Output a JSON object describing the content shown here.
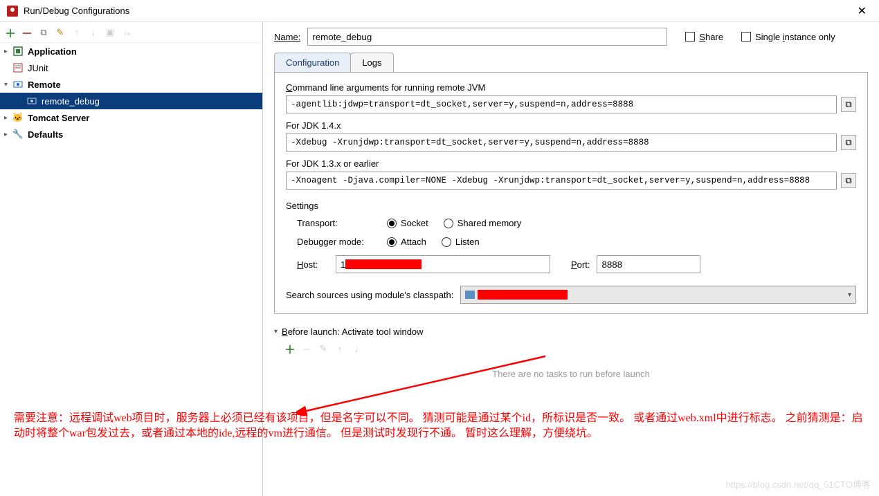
{
  "window": {
    "title": "Run/Debug Configurations"
  },
  "tree": {
    "items": [
      {
        "label": "Application",
        "bold": true,
        "expand": "▸",
        "iconColor": "#2e7d32"
      },
      {
        "label": "JUnit",
        "bold": false,
        "expand": "",
        "iconColor": "#c62828"
      },
      {
        "label": "Remote",
        "bold": true,
        "expand": "▾",
        "iconColor": "#1565c0"
      },
      {
        "label": "remote_debug",
        "child": true,
        "selected": true,
        "iconColor": "#1565c0"
      },
      {
        "label": "Tomcat Server",
        "bold": true,
        "expand": "▸",
        "iconColor": "#d4a017"
      },
      {
        "label": "Defaults",
        "bold": true,
        "expand": "▸",
        "iconColor": "#d4a017"
      }
    ]
  },
  "form": {
    "nameLabel": "Name:",
    "nameValue": "remote_debug",
    "shareLabel": "Share",
    "singleInstanceLabel": "Single instance only",
    "tabs": {
      "config": "Configuration",
      "logs": "Logs"
    },
    "cmdLineLabel": "Command line arguments for running remote JVM",
    "cmdLineValue": "-agentlib:jdwp=transport=dt_socket,server=y,suspend=n,address=8888",
    "jdk14Label": "For JDK 1.4.x",
    "jdk14Value": "-Xdebug -Xrunjdwp:transport=dt_socket,server=y,suspend=n,address=8888",
    "jdk13Label": "For JDK 1.3.x or earlier",
    "jdk13Value": "-Xnoagent -Djava.compiler=NONE -Xdebug -Xrunjdwp:transport=dt_socket,server=y,suspend=n,address=8888",
    "settingsLabel": "Settings",
    "transportLabel": "Transport:",
    "transportOpts": [
      "Socket",
      "Shared memory"
    ],
    "debuggerModeLabel": "Debugger mode:",
    "debuggerModeOpts": [
      "Attach",
      "Listen"
    ],
    "hostLabel": "Host:",
    "hostValuePrefix": "1",
    "portLabel": "Port:",
    "portValue": "8888",
    "searchSourcesLabel": "Search sources using module's classpath:",
    "beforeLaunchLabel": "Before launch: Activate tool window",
    "beforeLaunchEmpty": "There are no tasks to run before launch"
  },
  "annotation": "需要注意：远程调试web项目时，服务器上必须已经有该项目，但是名字可以不同。 猜测可能是通过某个id，所标识是否一致。 或者通过web.xml中进行标志。 之前猜测是：启动时将整个war包发过去，或者通过本地的ide,远程的vm进行通信。 但是测试时发现行不通。 暂时这么理解，方便绕坑。",
  "watermark": "https://blog.csdn.net/qq_51CTO博客"
}
